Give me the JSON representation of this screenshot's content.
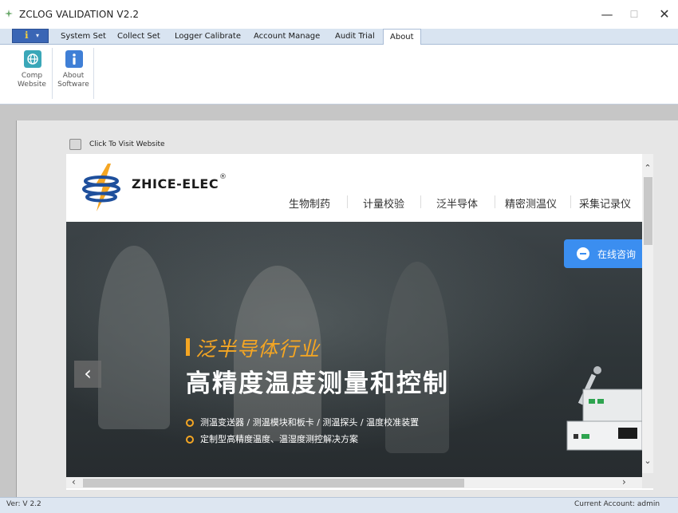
{
  "window": {
    "title": "ZCLOG VALIDATION  V2.2",
    "minimize_glyph": "—",
    "maximize_glyph": "☐",
    "close_glyph": "✕"
  },
  "menu_button": {
    "glyph": "ℹ",
    "caret": "▾"
  },
  "tabs": [
    {
      "label": "System Set"
    },
    {
      "label": "Collect Set"
    },
    {
      "label": "Logger Calibrate"
    },
    {
      "label": "Account Manage"
    },
    {
      "label": "Audit Trial"
    },
    {
      "label": "About"
    }
  ],
  "active_tab": "About",
  "ribbon": {
    "buttons": [
      {
        "line1": "Comp",
        "line2": "Website",
        "icon": "globe-icon"
      },
      {
        "line1": "About",
        "line2": "Software",
        "icon": "info-icon"
      }
    ]
  },
  "visit_website": {
    "label": "Click To Visit Website",
    "checked": false
  },
  "site": {
    "logo_text": "ZHICE-ELEC",
    "logo_reg": "®",
    "nav": [
      "生物制药",
      "计量校验",
      "泛半导体",
      "精密测温仪",
      "采集记录仪"
    ],
    "hero": {
      "subtitle": "泛半导体行业",
      "title": "高精度温度测量和控制",
      "bullets": [
        "测温变送器 / 测温模块和板卡 / 测温探头 / 温度校准装置",
        "定制型高精度温度、温湿度测控解决方案"
      ],
      "prev_arrow": "‹"
    },
    "consult_button": "在线咨询"
  },
  "scrollbars": {
    "up": "⌃",
    "down": "⌄",
    "left": "‹",
    "right": "›"
  },
  "status": {
    "version": "Ver:  V 2.2",
    "account": "Current Account:  admin"
  },
  "colors": {
    "accent_orange": "#f5a623",
    "consult_blue": "#3b8ef0",
    "ribbon_blue": "#3a66b5"
  }
}
